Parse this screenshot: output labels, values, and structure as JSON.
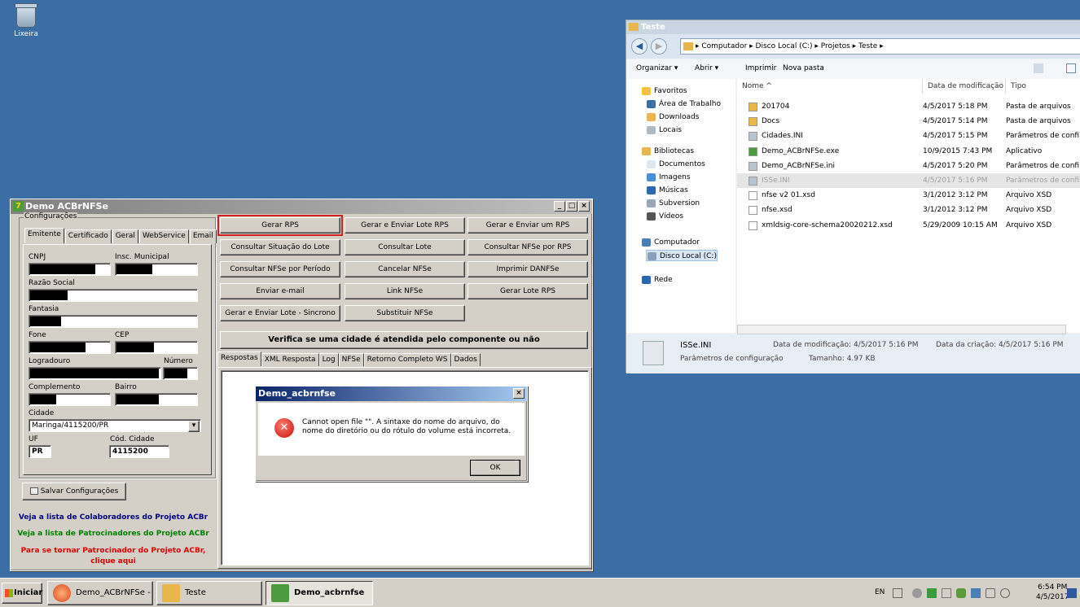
{
  "desktop": {
    "recycle_label": "Lixeira"
  },
  "app": {
    "title": "Demo ACBrNFSe",
    "config_legend": "Configurações",
    "tabs": [
      "Emitente",
      "Certificado",
      "Geral",
      "WebService",
      "Email"
    ],
    "labels": {
      "cnpj": "CNPJ",
      "insc": "Insc. Municipal",
      "razao": "Razão Social",
      "fantasia": "Fantasia",
      "fone": "Fone",
      "cep": "CEP",
      "logradouro": "Logradouro",
      "numero": "Número",
      "complemento": "Complemento",
      "bairro": "Bairro",
      "cidade": "Cidade",
      "uf": "UF",
      "cod_cidade": "Cód. Cidade"
    },
    "values": {
      "cidade": "Maringa/4115200/PR",
      "uf": "PR",
      "cod_cidade": "4115200"
    },
    "save_button": "Salvar Configurações",
    "link_colab": "Veja a lista de Colaboradores do Projeto ACBr",
    "link_patroc": "Veja a lista de Patrocinadores do Projeto ACBr",
    "link_tornar": "Para se tornar Patrocinador do Projeto ACBr, clique aqui",
    "buttons": {
      "gerar_rps": "Gerar RPS",
      "gerar_enviar_lote": "Gerar e Enviar Lote RPS",
      "gerar_enviar_um": "Gerar e Enviar um RPS",
      "consultar_situacao": "Consultar Situação do Lote",
      "consultar_lote": "Consultar Lote",
      "consultar_nfse_rps": "Consultar NFSe por RPS",
      "consultar_periodo": "Consultar NFSe por Período",
      "cancelar": "Cancelar NFSe",
      "imprimir": "Imprimir DANFSe",
      "enviar_email": "Enviar e-mail",
      "link_nfse": "Link NFSe",
      "gerar_lote": "Gerar Lote RPS",
      "gerar_enviar_sincrono": "Gerar e Enviar Lote - Sincrono",
      "substituir": "Substituir NFSe",
      "verifica": "Verifica se uma cidade é atendida pelo componente ou não"
    },
    "result_tabs": [
      "Respostas",
      "XML Resposta",
      "Log",
      "NFSe",
      "Retorno Completo WS",
      "Dados"
    ]
  },
  "dialog": {
    "title": "Demo_acbrnfse",
    "message": "Cannot open file \"\". A sintaxe do nome do arquivo, do nome do diretório ou do rótulo do volume está incorreta.",
    "ok": "OK"
  },
  "explorer": {
    "title": "Teste",
    "breadcrumb": "▸ Computador ▸ Disco Local (C:) ▸ Projetos ▸ Teste ▸",
    "toolbar": {
      "organizar": "Organizar ▾",
      "abrir": "Abrir ▾",
      "imprimir": "Imprimir",
      "nova_pasta": "Nova pasta"
    },
    "nav": [
      {
        "label": "Favoritos",
        "color": "#f5c242"
      },
      {
        "label": "Área de Trabalho",
        "color": "#3a6ea5"
      },
      {
        "label": "Downloads",
        "color": "#e8b64a"
      },
      {
        "label": "Locais",
        "color": "#b0b8c0"
      },
      {
        "label": "Bibliotecas",
        "color": "#e8b64a"
      },
      {
        "label": "Documentos",
        "color": "#dde7f2"
      },
      {
        "label": "Imagens",
        "color": "#4a90d9"
      },
      {
        "label": "Músicas",
        "color": "#2b67b5"
      },
      {
        "label": "Subversion",
        "color": "#9aa7b5"
      },
      {
        "label": "Vídeos",
        "color": "#555"
      },
      {
        "label": "Computador",
        "color": "#4a7fb5"
      },
      {
        "label": "Disco Local (C:)",
        "color": "#8aa0bd"
      },
      {
        "label": "Rede",
        "color": "#2b67b5"
      }
    ],
    "headers": {
      "nome": "Nome",
      "data": "Data de modificação",
      "tipo": "Tipo"
    },
    "files": [
      {
        "name": "201704",
        "date": "4/5/2017 5:18 PM",
        "type": "Pasta de arquivos",
        "icon": "folder-icon",
        "color": "#e8b64a"
      },
      {
        "name": "Docs",
        "date": "4/5/2017 5:14 PM",
        "type": "Pasta de arquivos",
        "icon": "folder-icon",
        "color": "#e8b64a"
      },
      {
        "name": "Cidades.INI",
        "date": "4/5/2017 5:15 PM",
        "type": "Parâmetros de confi...",
        "icon": "ini-icon",
        "color": "#b8c4d0"
      },
      {
        "name": "Demo_ACBrNFSe.exe",
        "date": "10/9/2015 7:43 PM",
        "type": "Aplicativo",
        "icon": "exe-icon",
        "color": "#4c9c3f"
      },
      {
        "name": "Demo_ACBrNFSe.ini",
        "date": "4/5/2017 5:20 PM",
        "type": "Parâmetros de confi...",
        "icon": "ini-icon",
        "color": "#b8c4d0"
      },
      {
        "name": "ISSe.INI",
        "date": "4/5/2017 5:16 PM",
        "type": "Parâmetros de confi...",
        "icon": "ini-icon",
        "color": "#b8c4d0"
      },
      {
        "name": "nfse v2 01.xsd",
        "date": "3/1/2012 3:12 PM",
        "type": "Arquivo XSD",
        "icon": "file-icon",
        "color": "#ffffff"
      },
      {
        "name": "nfse.xsd",
        "date": "3/1/2012 3:12 PM",
        "type": "Arquivo XSD",
        "icon": "file-icon",
        "color": "#ffffff"
      },
      {
        "name": "xmldsig-core-schema20020212.xsd",
        "date": "5/29/2009 10:15 AM",
        "type": "Arquivo XSD",
        "icon": "file-icon",
        "color": "#ffffff"
      }
    ],
    "details": {
      "name": "ISSe.INI",
      "type": "Parâmetros de configuração",
      "modified": "Data de modificação: 4/5/2017 5:16 PM",
      "created": "Data da criação: 4/5/2017 5:16 PM",
      "size": "Tamanho: 4.97 KB"
    }
  },
  "taskbar": {
    "start": "Iniciar",
    "tasks": [
      "Demo_ACBrNFSe - D...",
      "Teste",
      "Demo_acbrnfse"
    ],
    "lang": "EN",
    "time": "6:54 PM",
    "date": "4/5/2017"
  }
}
